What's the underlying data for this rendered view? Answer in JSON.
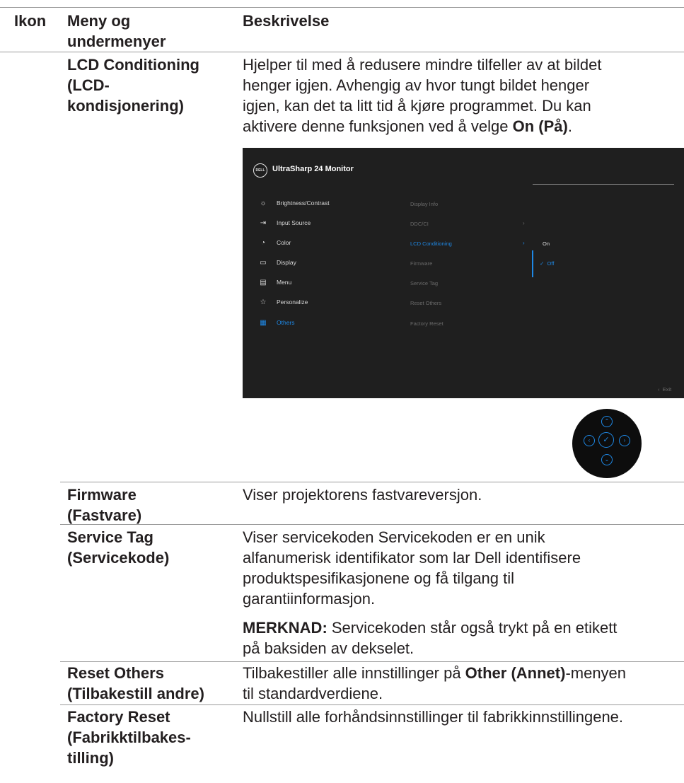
{
  "table": {
    "headers": {
      "icon": "Ikon",
      "menu_line1": "Meny og",
      "menu_line2": "undermenyer",
      "desc": "Beskrivelse"
    },
    "lcd": {
      "name_lines": [
        "LCD Conditioning",
        "(LCD-",
        "kondisjonering)"
      ],
      "desc_lines": [
        "Hjelper til med å redusere mindre tilfeller av at bildet",
        "henger igjen. Avhengig av hvor tungt bildet henger",
        "igjen, kan det ta litt tid å kjøre programmet. Du kan"
      ],
      "desc_last_prefix": "aktivere denne funksjonen ved å velge ",
      "desc_last_bold": "On (På)",
      "desc_last_suffix": "."
    },
    "firmware": {
      "name_lines": [
        "Firmware",
        "(Fastvare)"
      ],
      "desc": "Viser projektorens fastvareversjon."
    },
    "service_tag": {
      "name_lines": [
        "Service Tag",
        "(Servicekode)"
      ],
      "desc_lines": [
        "Viser servicekoden Servicekoden er en unik",
        "alfanumerisk identifikator som lar Dell identifisere",
        "produktspesifikasjonene og få tilgang til",
        "garantiinformasjon."
      ],
      "note_label": "MERKNAD:",
      "note_line1": " Servicekoden står også trykt på en etikett",
      "note_line2": "på baksiden av dekselet."
    },
    "reset_others": {
      "name_lines": [
        "Reset Others",
        "(Tilbakestill andre)"
      ],
      "desc_prefix": "Tilbakestiller alle innstillinger på ",
      "desc_bold": "Other (Annet)",
      "desc_suffix": "-menyen",
      "desc_line2": "til standardverdiene."
    },
    "factory_reset": {
      "name_lines": [
        "Factory Reset",
        "(Fabrikktilbakes-",
        "tilling)"
      ],
      "desc": "Nullstill alle forhåndsinnstillinger til fabrikkinnstillingene."
    }
  },
  "osd": {
    "logo": "DELL",
    "title": "UltraSharp 24 Monitor",
    "menu": [
      {
        "label": "Brightness/Contrast",
        "icon": "sun-icon",
        "glyph": "☼",
        "active": false
      },
      {
        "label": "Input Source",
        "icon": "input-icon",
        "glyph": "⇥",
        "active": false
      },
      {
        "label": "Color",
        "icon": "palette-icon",
        "glyph": "◔",
        "active": false
      },
      {
        "label": "Display",
        "icon": "monitor-icon",
        "glyph": "▭",
        "active": false
      },
      {
        "label": "Menu",
        "icon": "menu-icon",
        "glyph": "▤",
        "active": false
      },
      {
        "label": "Personalize",
        "icon": "star-icon",
        "glyph": "☆",
        "active": false
      },
      {
        "label": "Others",
        "icon": "others-icon",
        "glyph": "▦",
        "active": true
      }
    ],
    "submenu": [
      {
        "label": "Display Info",
        "active": false
      },
      {
        "label": "DDC/CI",
        "active": false
      },
      {
        "label": "LCD Conditioning",
        "active": true
      },
      {
        "label": "Firmware",
        "active": false
      },
      {
        "label": "Service Tag",
        "active": false
      },
      {
        "label": "Reset Others",
        "active": false
      },
      {
        "label": "Factory Reset",
        "active": false
      }
    ],
    "chevron": "›",
    "options": {
      "on": "On",
      "off": "Off",
      "check": "✓"
    },
    "exit_chevron": "‹",
    "exit": "Exit",
    "accent_color": "#1e88e5",
    "background_color": "#1f1f1f"
  },
  "joystick": {
    "up": "⌃",
    "down": "⌄",
    "left": "‹",
    "right": "›",
    "center": "✓"
  }
}
